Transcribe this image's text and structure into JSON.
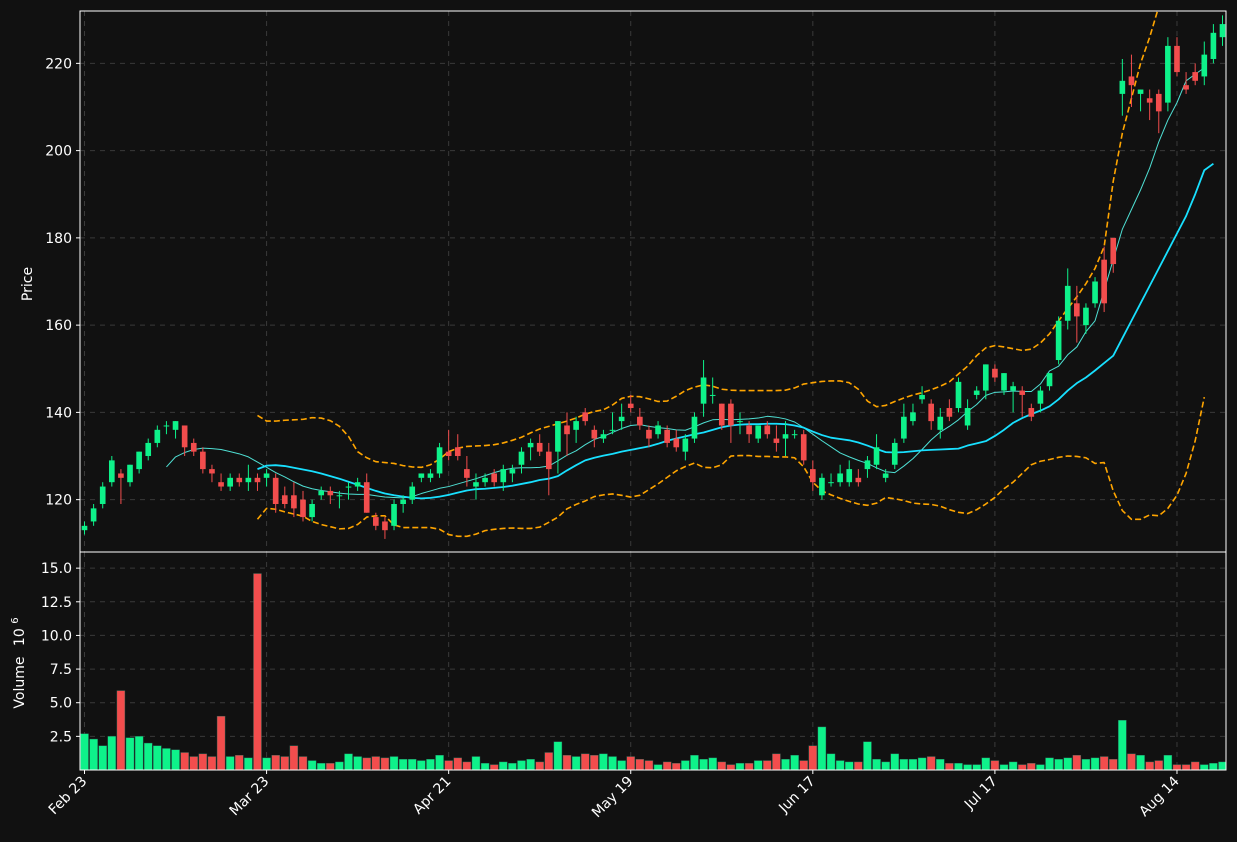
{
  "chart_data": {
    "type": "candlestick",
    "panels": [
      {
        "name": "price",
        "ylabel": "Price",
        "ylim": [
          108,
          232
        ],
        "yticks": [
          120,
          140,
          160,
          180,
          200,
          220
        ],
        "grid": true
      },
      {
        "name": "volume",
        "ylabel": "Volume  10^6",
        "ylabel_main": "Volume",
        "ylabel_exp": "10",
        "ylabel_sup": "6",
        "ylim": [
          0,
          16.2
        ],
        "yticks": [
          2.5,
          5.0,
          7.5,
          10.0,
          12.5,
          15.0
        ],
        "ytick_labels": [
          "2.5",
          "5.0",
          "7.5",
          "10.0",
          "12.5",
          "15.0"
        ],
        "grid": true
      }
    ],
    "x_tick_labels": [
      {
        "index": 0,
        "label": "Feb 23"
      },
      {
        "index": 20,
        "label": "Mar 23"
      },
      {
        "index": 40,
        "label": "Apr 21"
      },
      {
        "index": 60,
        "label": "May 19"
      },
      {
        "index": 80,
        "label": "Jun 17"
      },
      {
        "index": 100,
        "label": "Jul 17"
      },
      {
        "index": 120,
        "label": "Aug 14"
      }
    ],
    "candles": [
      [
        113,
        115,
        112,
        114
      ],
      [
        115,
        119,
        114,
        118
      ],
      [
        119,
        124,
        118,
        123
      ],
      [
        124,
        130,
        123,
        129
      ],
      [
        126,
        127,
        119,
        125
      ],
      [
        124,
        128,
        123,
        128
      ],
      [
        127,
        131,
        126,
        131
      ],
      [
        130,
        134,
        129,
        133
      ],
      [
        133,
        137,
        132,
        136
      ],
      [
        137,
        138,
        135,
        137
      ],
      [
        136,
        138,
        134,
        138
      ],
      [
        137,
        137,
        130,
        132
      ],
      [
        133,
        134,
        130,
        131
      ],
      [
        131,
        132,
        126,
        127
      ],
      [
        127,
        128,
        124,
        126
      ],
      [
        124,
        126,
        122,
        123
      ],
      [
        123,
        126,
        122,
        125
      ],
      [
        125,
        126,
        123,
        124
      ],
      [
        124,
        128,
        122,
        125
      ],
      [
        125,
        126,
        122,
        124
      ],
      [
        125,
        127,
        123,
        126
      ],
      [
        125,
        126,
        117,
        119
      ],
      [
        121,
        123,
        118,
        119
      ],
      [
        121,
        124,
        116,
        118
      ],
      [
        120,
        122,
        115,
        116
      ],
      [
        116,
        120,
        115,
        119
      ],
      [
        121,
        123,
        120,
        122
      ],
      [
        122,
        123,
        119,
        121
      ],
      [
        121,
        122,
        118,
        121
      ],
      [
        123,
        124,
        120,
        123
      ],
      [
        123,
        125,
        122,
        124
      ],
      [
        124,
        126,
        117,
        117
      ],
      [
        116,
        117,
        113,
        114
      ],
      [
        115,
        116,
        111,
        113
      ],
      [
        114,
        120,
        113,
        119
      ],
      [
        119,
        121,
        117,
        120
      ],
      [
        120,
        124,
        119,
        123
      ],
      [
        125,
        126,
        124,
        126
      ],
      [
        125,
        127,
        124,
        126
      ],
      [
        126,
        133,
        125,
        132
      ],
      [
        131,
        136,
        129,
        130
      ],
      [
        132,
        135,
        129,
        130
      ],
      [
        127,
        130,
        123,
        125
      ],
      [
        123,
        126,
        120,
        124
      ],
      [
        124,
        126,
        123,
        125
      ],
      [
        126,
        127,
        123,
        124
      ],
      [
        124,
        128,
        122,
        127
      ],
      [
        126,
        128,
        124,
        127
      ],
      [
        128,
        132,
        126,
        131
      ],
      [
        132,
        134,
        129,
        133
      ],
      [
        133,
        135,
        130,
        131
      ],
      [
        131,
        133,
        121,
        127
      ],
      [
        131,
        138,
        126,
        138
      ],
      [
        137,
        140,
        130,
        135
      ],
      [
        136,
        139,
        133,
        138
      ],
      [
        140,
        141,
        137,
        138
      ],
      [
        136,
        137,
        132,
        134
      ],
      [
        134,
        136,
        133,
        135
      ],
      [
        136,
        140,
        135,
        136
      ],
      [
        138,
        142,
        136,
        139
      ],
      [
        142,
        144,
        140,
        141
      ],
      [
        139,
        141,
        136,
        137
      ],
      [
        136,
        137,
        132,
        134
      ],
      [
        135,
        138,
        134,
        137
      ],
      [
        136,
        137,
        132,
        133
      ],
      [
        134,
        136,
        131,
        132
      ],
      [
        131,
        135,
        129,
        134
      ],
      [
        134,
        140,
        133,
        139
      ],
      [
        142,
        152,
        139,
        148
      ],
      [
        144,
        148,
        142,
        144
      ],
      [
        142,
        142,
        136,
        137
      ],
      [
        142,
        143,
        133,
        137
      ],
      [
        138,
        140,
        135,
        138
      ],
      [
        137,
        138,
        133,
        135
      ],
      [
        134,
        136,
        133,
        137
      ],
      [
        137,
        138,
        134,
        135
      ],
      [
        134,
        137,
        131,
        133
      ],
      [
        134,
        138,
        130,
        135
      ],
      [
        135,
        136,
        134,
        135
      ],
      [
        135,
        136,
        128,
        129
      ],
      [
        127,
        129,
        122,
        124
      ],
      [
        121,
        126,
        120,
        125
      ],
      [
        124,
        126,
        123,
        124
      ],
      [
        124,
        128,
        123,
        126
      ],
      [
        124,
        129,
        123,
        127
      ],
      [
        125,
        127,
        123,
        124
      ],
      [
        127,
        130,
        125,
        129
      ],
      [
        128,
        135,
        127,
        132
      ],
      [
        125,
        127,
        124,
        126
      ],
      [
        128,
        134,
        127,
        133
      ],
      [
        134,
        142,
        133,
        139
      ],
      [
        138,
        142,
        137,
        140
      ],
      [
        143,
        146,
        142,
        144
      ],
      [
        142,
        143,
        136,
        138
      ],
      [
        136,
        141,
        134,
        139
      ],
      [
        141,
        143,
        138,
        139
      ],
      [
        141,
        148,
        140,
        147
      ],
      [
        137,
        143,
        136,
        141
      ],
      [
        144,
        146,
        143,
        145
      ],
      [
        145,
        151,
        143,
        151
      ],
      [
        150,
        151,
        147,
        148
      ],
      [
        145,
        149,
        144,
        149
      ],
      [
        145,
        147,
        140,
        146
      ],
      [
        145,
        146,
        139,
        144
      ],
      [
        141,
        142,
        138,
        139
      ],
      [
        142,
        146,
        140,
        145
      ],
      [
        146,
        149,
        145,
        149
      ],
      [
        152,
        162,
        151,
        161
      ],
      [
        161,
        173,
        159,
        169
      ],
      [
        165,
        169,
        156,
        162
      ],
      [
        160,
        165,
        158,
        164
      ],
      [
        165,
        171,
        164,
        170
      ],
      [
        175,
        178,
        163,
        165
      ],
      [
        180,
        179,
        172,
        174
      ],
      [
        213,
        221,
        208,
        216
      ],
      [
        217,
        222,
        210,
        215
      ],
      [
        213,
        214,
        209,
        214
      ],
      [
        212,
        214,
        207,
        211
      ],
      [
        213,
        214,
        204,
        209
      ],
      [
        211,
        226,
        209,
        224
      ],
      [
        224,
        226,
        217,
        218
      ],
      [
        215,
        218,
        213,
        214
      ],
      [
        218,
        220,
        215,
        216
      ],
      [
        217,
        225,
        215,
        222
      ],
      [
        221,
        229,
        220,
        227
      ],
      [
        226,
        231,
        224,
        229
      ]
    ],
    "volume": [
      2.7,
      2.3,
      1.8,
      2.5,
      5.9,
      2.4,
      2.5,
      2.0,
      1.8,
      1.6,
      1.5,
      1.3,
      1.0,
      1.2,
      1.0,
      4.0,
      1.0,
      1.1,
      0.9,
      14.6,
      0.9,
      1.1,
      1.0,
      1.8,
      1.0,
      0.7,
      0.5,
      0.5,
      0.6,
      1.2,
      1.0,
      0.9,
      1.0,
      0.9,
      1.0,
      0.8,
      0.8,
      0.7,
      0.8,
      1.1,
      0.7,
      0.9,
      0.6,
      1.0,
      0.5,
      0.4,
      0.6,
      0.5,
      0.7,
      0.8,
      0.6,
      1.3,
      2.1,
      1.1,
      1.0,
      1.2,
      1.1,
      1.2,
      1.0,
      0.7,
      1.0,
      0.8,
      0.7,
      0.4,
      0.6,
      0.5,
      0.7,
      1.1,
      0.8,
      0.9,
      0.6,
      0.4,
      0.5,
      0.5,
      0.7,
      0.7,
      1.2,
      0.8,
      1.1,
      0.7,
      1.8,
      3.2,
      1.2,
      0.7,
      0.6,
      0.6,
      2.1,
      0.8,
      0.6,
      1.2,
      0.8,
      0.8,
      0.9,
      1.0,
      0.8,
      0.5,
      0.5,
      0.4,
      0.4,
      0.9,
      0.7,
      0.4,
      0.6,
      0.4,
      0.5,
      0.4,
      0.9,
      0.8,
      0.9,
      1.1,
      0.8,
      0.9,
      1.0,
      0.8,
      3.7,
      1.2,
      1.1,
      0.6,
      0.7,
      1.1,
      0.4,
      0.4,
      0.6,
      0.4,
      0.5,
      0.6
    ],
    "overlays": {
      "ma_short": [
        null,
        null,
        null,
        null,
        null,
        null,
        null,
        null,
        null,
        127.5,
        129.8,
        130.8,
        131.5,
        131.8,
        131.7,
        131.5,
        131.0,
        130.5,
        129.8,
        128.6,
        127.4,
        126.2,
        125.2,
        124.1,
        123.1,
        122.5,
        122.1,
        121.8,
        121.5,
        121.3,
        121.2,
        121.2,
        120.9,
        120.6,
        120.5,
        120.4,
        120.7,
        121.4,
        122.0,
        122.6,
        123.0,
        123.6,
        124.2,
        124.8,
        125.5,
        126.2,
        126.8,
        127.2,
        127.3,
        127.3,
        127.4,
        127.7,
        128.9,
        130.2,
        131.2,
        132.6,
        133.8,
        134.5,
        135.4,
        136.3,
        137.0,
        137.2,
        136.8,
        136.5,
        136.3,
        136.0,
        135.9,
        136.7,
        137.6,
        138.3,
        138.4,
        138.3,
        138.4,
        138.5,
        138.7,
        139.1,
        138.9,
        138.5,
        137.8,
        136.5,
        135.0,
        133.5,
        132.1,
        130.7,
        129.8,
        129.0,
        128.3,
        127.3,
        126.4,
        126.2,
        127.7,
        129.4,
        131.5,
        133.7,
        135.5,
        136.8,
        138.3,
        140.2,
        141.8,
        143.9,
        144.6,
        144.7,
        144.9,
        144.8,
        144.8,
        146.5,
        149.5,
        150.6,
        153.2,
        155.0,
        158.5,
        161.0,
        168.0,
        175.0,
        182.0,
        186.5,
        191.0,
        196.0,
        202.0,
        207.0,
        211.0,
        216.0,
        217.5,
        219.0
      ],
      "ma_long": [
        null,
        null,
        null,
        null,
        null,
        null,
        null,
        null,
        null,
        null,
        null,
        null,
        null,
        null,
        null,
        null,
        null,
        null,
        null,
        127.0,
        127.8,
        127.9,
        127.7,
        127.3,
        126.9,
        126.5,
        126.0,
        125.4,
        124.8,
        124.1,
        123.4,
        122.7,
        122.0,
        121.4,
        121.0,
        120.7,
        120.4,
        120.3,
        120.4,
        120.7,
        121.1,
        121.6,
        122.1,
        122.4,
        122.5,
        122.7,
        122.9,
        123.2,
        123.6,
        124.0,
        124.5,
        124.8,
        125.4,
        126.7,
        127.9,
        129.0,
        129.6,
        130.1,
        130.5,
        131.0,
        131.4,
        131.8,
        132.2,
        132.8,
        133.5,
        134.0,
        134.5,
        135.0,
        135.4,
        136.0,
        136.6,
        137.0,
        137.2,
        137.3,
        137.3,
        137.4,
        137.4,
        137.3,
        137.0,
        136.5,
        135.6,
        134.8,
        134.2,
        133.9,
        133.6,
        133.1,
        132.4,
        131.6,
        130.9,
        130.8,
        130.9,
        131.1,
        131.3,
        131.4,
        131.5,
        131.6,
        131.7,
        132.4,
        132.9,
        133.4,
        134.6,
        136.0,
        137.6,
        138.7,
        139.6,
        140.4,
        141.4,
        143.0,
        145.0,
        146.7,
        148.0,
        149.6,
        151.3,
        153.0,
        157.0,
        161.0,
        165.0,
        169.0,
        173.0,
        177.0,
        181.0,
        185.0,
        190.0,
        195.5,
        197.0
      ],
      "bb_upper": [
        null,
        null,
        null,
        null,
        null,
        null,
        null,
        null,
        null,
        null,
        null,
        null,
        null,
        null,
        null,
        null,
        null,
        null,
        null,
        139.3,
        138.0,
        138.0,
        138.2,
        138.3,
        138.4,
        138.8,
        138.7,
        138.1,
        136.8,
        134.5,
        131.0,
        129.6,
        128.7,
        128.5,
        128.3,
        127.8,
        127.5,
        127.4,
        128.0,
        129.3,
        131.0,
        131.8,
        132.2,
        132.3,
        132.4,
        132.6,
        133.0,
        133.6,
        134.3,
        135.3,
        136.2,
        136.8,
        137.4,
        138.0,
        138.7,
        139.6,
        140.2,
        140.6,
        141.7,
        143.2,
        143.7,
        143.6,
        143.1,
        142.5,
        142.6,
        143.7,
        145.0,
        145.8,
        146.3,
        146.0,
        145.3,
        145.1,
        145.0,
        145.0,
        145.0,
        145.0,
        145.0,
        145.1,
        145.6,
        146.5,
        146.8,
        147.1,
        147.2,
        147.2,
        146.8,
        145.3,
        142.6,
        141.3,
        141.6,
        142.5,
        143.3,
        144.0,
        144.5,
        145.2,
        146.0,
        147.0,
        148.8,
        150.6,
        153.0,
        154.8,
        155.3,
        155.0,
        154.6,
        154.2,
        154.5,
        155.9,
        158.0,
        161.0,
        163.8,
        166.5,
        169.5,
        173.0,
        178.0,
        193.0,
        204.0,
        212.0,
        220.0,
        226.0,
        233.0,
        240.0,
        246.0,
        250.0
      ],
      "bb_lower": [
        null,
        null,
        null,
        null,
        null,
        null,
        null,
        null,
        null,
        null,
        null,
        null,
        null,
        null,
        null,
        null,
        null,
        null,
        null,
        115.5,
        118.0,
        117.8,
        117.2,
        116.7,
        116.2,
        115.0,
        114.3,
        113.8,
        113.3,
        113.4,
        114.3,
        116.0,
        116.3,
        116.3,
        114.2,
        113.6,
        113.6,
        113.6,
        113.6,
        113.2,
        112.0,
        111.6,
        111.6,
        112.1,
        112.9,
        113.2,
        113.4,
        113.5,
        113.4,
        113.4,
        113.7,
        114.8,
        116.0,
        117.9,
        118.9,
        119.7,
        120.7,
        121.1,
        121.3,
        121.0,
        120.6,
        121.0,
        122.3,
        123.6,
        125.1,
        126.6,
        127.6,
        128.4,
        127.4,
        127.3,
        128.0,
        130.0,
        130.1,
        130.1,
        129.9,
        129.9,
        129.8,
        129.8,
        129.6,
        127.5,
        124.0,
        122.0,
        121.1,
        120.3,
        119.6,
        119.0,
        118.7,
        119.2,
        120.5,
        120.2,
        119.8,
        119.2,
        119.0,
        118.9,
        118.5,
        117.7,
        117.1,
        116.8,
        117.7,
        119.0,
        120.5,
        122.5,
        124.0,
        126.0,
        128.0,
        128.8,
        129.2,
        129.7,
        130.0,
        129.9,
        129.6,
        128.3,
        128.5,
        122.0,
        117.5,
        115.5,
        115.5,
        116.5,
        116.3,
        118.0,
        121.0,
        126.0,
        133.5,
        143.5
      ]
    },
    "colors": {
      "background": "#111111",
      "up": "#0ef28a",
      "down": "#f24d4d",
      "ma_short": "#4fe0d4",
      "ma_long": "#18e0ff",
      "bollinger": "#ffa500",
      "grid": "#3a3a3a",
      "frame": "#ffffff",
      "text": "#ffffff"
    }
  }
}
